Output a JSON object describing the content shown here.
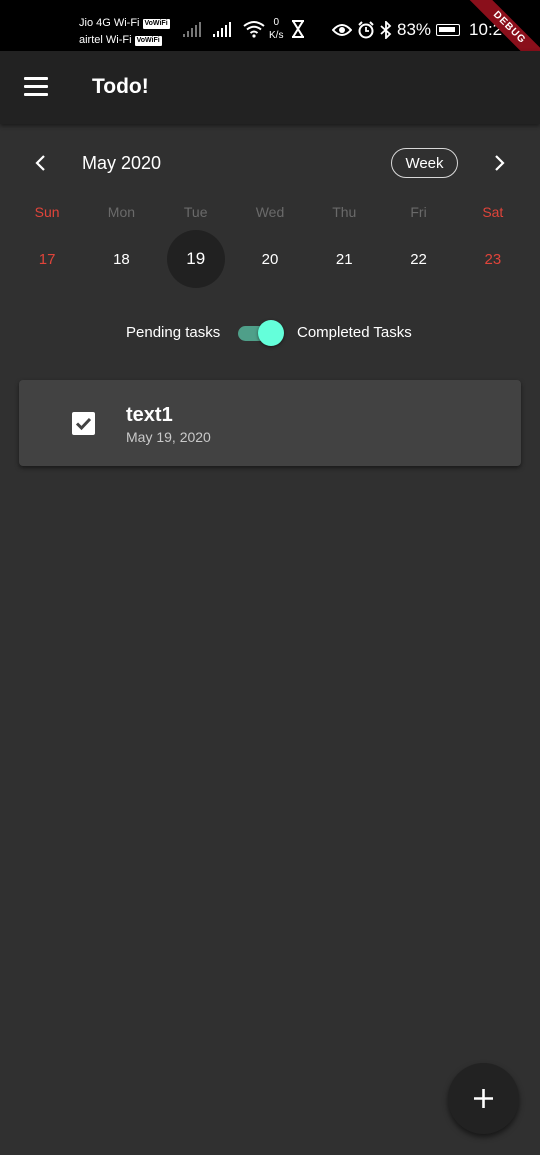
{
  "status_bar": {
    "carrier1": "Jio 4G Wi-Fi",
    "carrier1_badge": "VoWiFi",
    "carrier2": "airtel Wi-Fi",
    "carrier2_badge": "VoWiFi",
    "net_speed_value": "0",
    "net_speed_unit": "K/s",
    "battery": "83%",
    "time": "10:28",
    "debug_banner": "DEBUG"
  },
  "app_bar": {
    "title": "Todo!",
    "menu_icon": "hamburger-menu-icon"
  },
  "calendar": {
    "month": "May 2020",
    "format_button": "Week",
    "weekdays": [
      "Sun",
      "Mon",
      "Tue",
      "Wed",
      "Thu",
      "Fri",
      "Sat"
    ],
    "dates": [
      "17",
      "18",
      "19",
      "20",
      "21",
      "22",
      "23"
    ],
    "selected_date": "19",
    "weekend_color": "#e0443a"
  },
  "filter": {
    "pending_label": "Pending tasks",
    "completed_label": "Completed Tasks",
    "show_completed": true,
    "accent_color": "#64ffda"
  },
  "tasks": [
    {
      "title": "text1",
      "date": "May 19, 2020",
      "completed": true
    }
  ],
  "fab": {
    "icon": "add-icon"
  }
}
